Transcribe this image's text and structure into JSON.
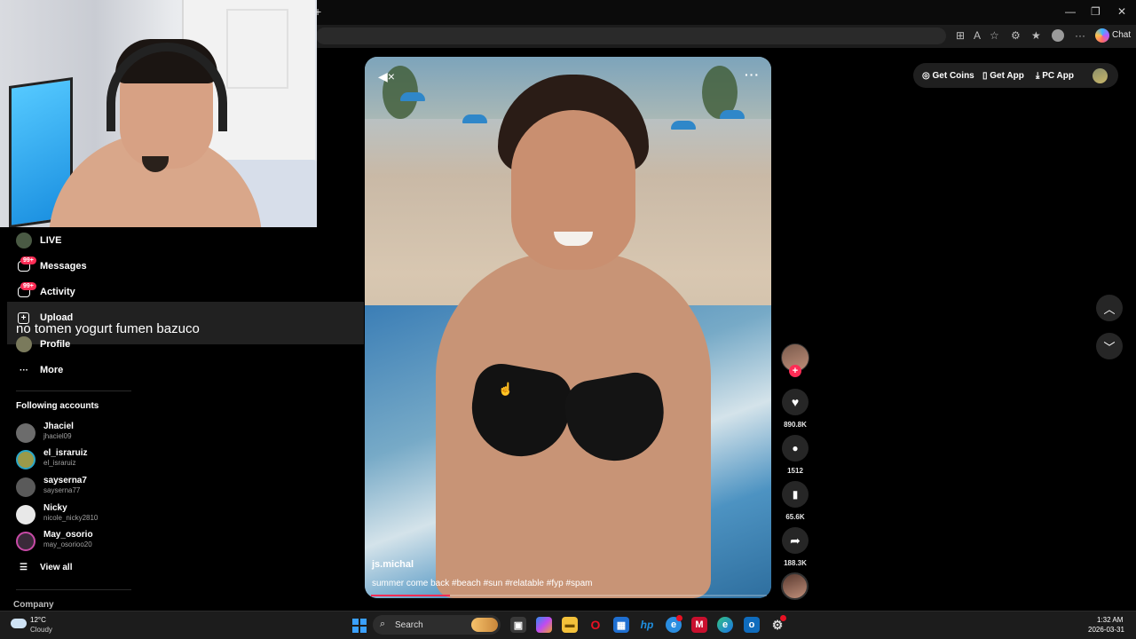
{
  "browser": {
    "new_tab_icon": "plus-icon",
    "chat_label": "Chat"
  },
  "sidebar": {
    "items": [
      {
        "label": "LIVE",
        "icon": "live-icon"
      },
      {
        "label": "Messages",
        "icon": "messages-icon",
        "badge": "99+"
      },
      {
        "label": "Activity",
        "icon": "activity-icon",
        "badge": "99+"
      },
      {
        "label": "Upload",
        "icon": "upload-icon"
      },
      {
        "label": "Profile",
        "icon": "profile-icon"
      },
      {
        "label": "More",
        "icon": "more-icon"
      }
    ],
    "stream_caption": "no tomen yogurt fumen bazuco",
    "following_title": "Following accounts",
    "accounts": [
      {
        "name": "Jhaciel",
        "handle": "jhaciel09"
      },
      {
        "name": "el_israruiz",
        "handle": "el_israruiz"
      },
      {
        "name": "sayserna7",
        "handle": "sayserna77"
      },
      {
        "name": "Nicky",
        "handle": "nicole_nicky2810"
      },
      {
        "name": "May_osorio",
        "handle": "may_osorioo20"
      }
    ],
    "view_all": "View all",
    "company": "Company"
  },
  "video": {
    "author": "js.michal",
    "description": "summer come back #beach #sun #relatable #fyp #spam",
    "more_label": "···",
    "progress": 0.2,
    "likes": "890.8K",
    "comments": "1512",
    "saves": "65.6K",
    "shares": "188.3K"
  },
  "topbar": {
    "get_coins": "Get Coins",
    "get_app": "Get App",
    "pc_app": "PC App"
  },
  "taskbar": {
    "temperature": "12°C",
    "condition": "Cloudy",
    "search_label": "Search",
    "time": "1:32 AM",
    "date": "2026-03-31"
  },
  "colors": {
    "accent": "#fe2c55",
    "background": "#000000",
    "rail_button": "#262626"
  }
}
